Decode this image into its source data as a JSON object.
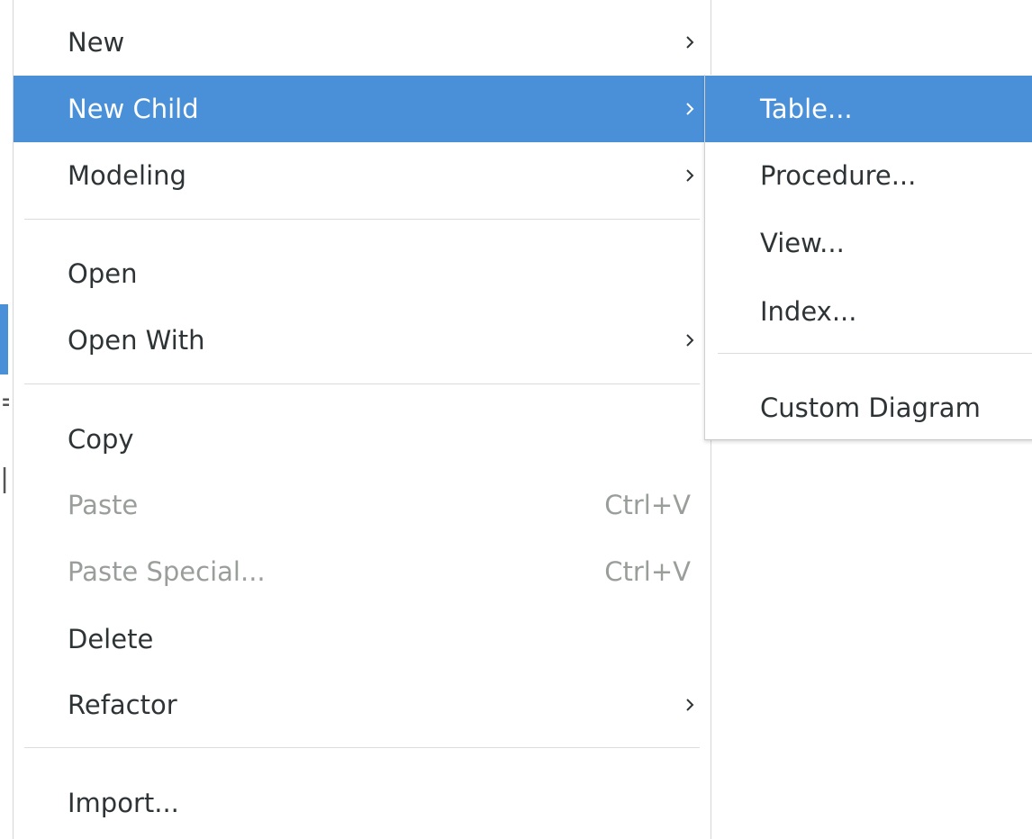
{
  "context_menu": {
    "items": [
      {
        "label": "New",
        "has_submenu": true
      },
      {
        "label": "New Child",
        "has_submenu": true,
        "highlighted": true
      },
      {
        "label": "Modeling",
        "has_submenu": true
      },
      {
        "label": "Open"
      },
      {
        "label": "Open With",
        "has_submenu": true
      },
      {
        "label": "Copy"
      },
      {
        "label": "Paste",
        "shortcut": "Ctrl+V",
        "disabled": true
      },
      {
        "label": "Paste Special...",
        "shortcut": "Ctrl+V",
        "disabled": true
      },
      {
        "label": "Delete"
      },
      {
        "label": "Refactor",
        "has_submenu": true
      },
      {
        "label": "Import..."
      }
    ]
  },
  "new_child_submenu": {
    "items": [
      {
        "label": "Table...",
        "highlighted": true
      },
      {
        "label": "Procedure..."
      },
      {
        "label": "View..."
      },
      {
        "label": "Index..."
      },
      {
        "label": "Custom Diagram"
      }
    ]
  },
  "colors": {
    "highlight": "#4a90d9",
    "text": "#2e3436",
    "disabled_text": "#9a9e9a",
    "separator": "#dcdcdc"
  },
  "icons": {
    "submenu_arrow": "chevron-right-icon"
  }
}
